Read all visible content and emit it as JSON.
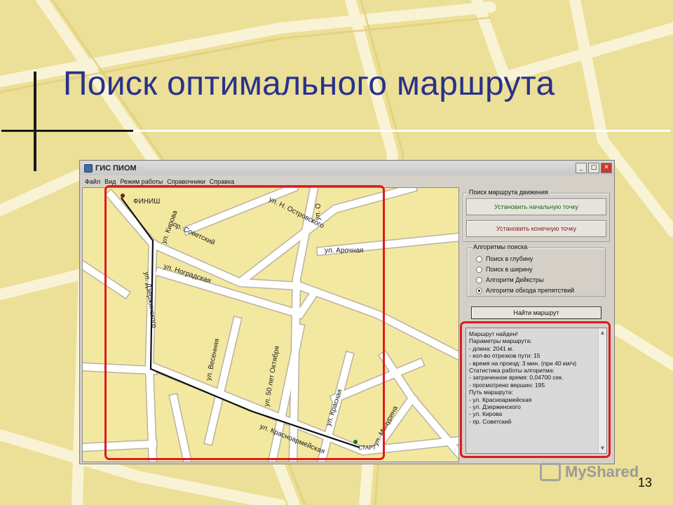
{
  "slide": {
    "title": "Поиск оптимального маршрута",
    "page_number": "13",
    "watermark": "MyShared"
  },
  "window": {
    "title": "ГИС ПИОМ",
    "controls": {
      "minimize": "_",
      "maximize": "□",
      "close": "✕"
    },
    "menu": [
      "Файл",
      "Вид",
      "Режим работы",
      "Справочники",
      "Справка"
    ]
  },
  "map": {
    "streets": [
      "ул. Н. Островского",
      "ул. Кирова",
      "пр. Советский",
      "ул. Ноградская",
      "ул. Дзержинского",
      "ул. Арочная",
      "ул. Весенняя",
      "ул. 50 лет Октября",
      "ул. Красная",
      "ул. Мичурина",
      "ул. Красноармейская",
      "ул. О"
    ],
    "finish_label": "ФИНИШ",
    "start_label": "СТАРТ",
    "colors": {
      "ground": "#f3e8a0",
      "road": "#ffffff",
      "route": "#111111",
      "frame": "#e01a1a"
    }
  },
  "panel": {
    "route_group": {
      "label": "Поиск маршрута движения",
      "set_start": "Установить начальную точку",
      "set_end": "Установить конечную точку"
    },
    "algorithms": {
      "label": "Алгоритмы поиска",
      "options": [
        {
          "label": "Поиск в глубину",
          "selected": false
        },
        {
          "label": "Поиск в ширину",
          "selected": false
        },
        {
          "label": "Алгоритм Дейкстры",
          "selected": false
        },
        {
          "label": "Алгоритм обхода препятствий",
          "selected": true
        }
      ]
    },
    "find_button": "Найти маршрут",
    "result": [
      "Маршрут найден!",
      "Параметры маршрута:",
      "  - длина: 2041 м.",
      "  - кол-во отрезков пути: 15",
      "  - время на проезд: 3 мин. (при 40 км/ч)",
      "Статистика работы алгоритма:",
      "  - затраченное время: 0,04700 сек.",
      "  - просмотрено вершин: 195",
      "Путь маршрута:",
      "  - ул. Красноармейская",
      "  - ул. Дзержинского",
      "  - ул. Кирова",
      "  - пр. Советский"
    ]
  }
}
